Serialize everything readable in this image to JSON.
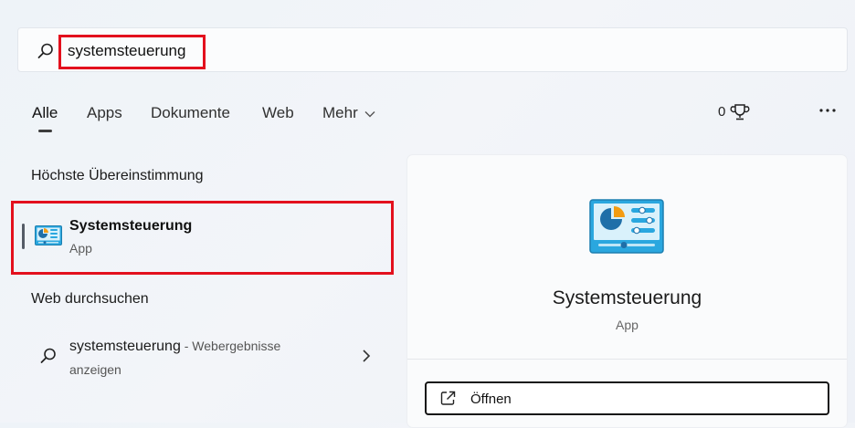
{
  "search": {
    "query": "systemsteuerung"
  },
  "tabs": [
    {
      "label": "Alle"
    },
    {
      "label": "Apps"
    },
    {
      "label": "Dokumente"
    },
    {
      "label": "Web"
    },
    {
      "label": "Mehr"
    }
  ],
  "header": {
    "points": "0"
  },
  "best_match": {
    "section_title": "Höchste Übereinstimmung",
    "title": "Systemsteuerung",
    "subtitle": "App"
  },
  "web_search": {
    "section_title": "Web durchsuchen",
    "query": "systemsteuerung",
    "suffix": " - Webergebnisse",
    "line2": "anzeigen"
  },
  "detail_panel": {
    "title": "Systemsteuerung",
    "subtitle": "App",
    "open_label": "Öffnen"
  },
  "colors": {
    "highlight": "#e3101d",
    "icon_blue": "#29a8e0",
    "icon_orange": "#f39c12"
  }
}
